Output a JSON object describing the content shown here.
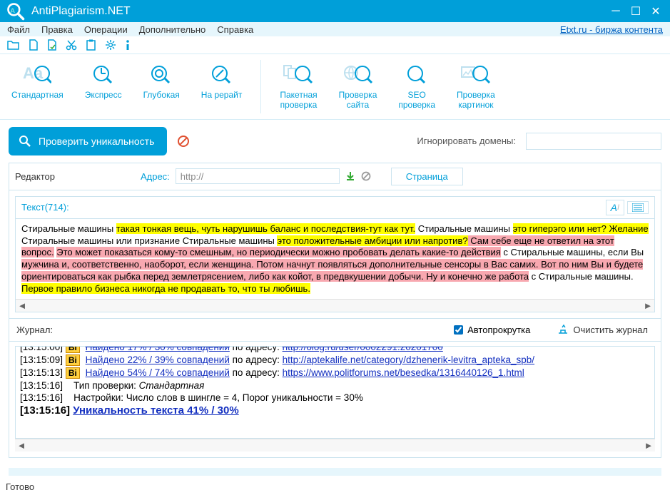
{
  "titlebar": {
    "title": "AntiPlagiarism.NET"
  },
  "menubar": {
    "items": [
      "Файл",
      "Правка",
      "Операции",
      "Дополнительно",
      "Справка"
    ],
    "etxt_link": "Etxt.ru - биржа контента"
  },
  "toolbar_big": {
    "group1": [
      "Стандартная",
      "Экспресс",
      "Глубокая",
      "На рерайт"
    ],
    "group2": [
      "Пакетная\nпроверка",
      "Проверка\nсайта",
      "SEO\nпроверка",
      "Проверка\nкартинок"
    ]
  },
  "check_row": {
    "check_btn": "Проверить уникальность",
    "ignore_label": "Игнорировать домены:",
    "ignore_value": ""
  },
  "editor": {
    "title": "Редактор",
    "addr_label": "Адрес:",
    "addr_value": "http://",
    "tab": "Страница",
    "text_label": "Текст(714):",
    "content": {
      "s1": "Стиральные машины ",
      "s2": "такая тонкая вещь, чуть нарушишь баланс и последствия-тут как тут.",
      "s3": " Стиральные машины ",
      "s4": "это гиперэго или нет? Желание",
      "s5": " Стиральные машины ",
      "s6": "или признание",
      "s7": " Стиральные машины ",
      "s8": "это положительные амбиции или напротив?",
      "s9": " Сам себе еще не ответил на этот вопрос.",
      "s10": " ",
      "s11": "Это может показаться кому-то смешным, но периодически можно пробовать делать какие-то действия",
      "s12": " с Стиральные машины, если Вы ",
      "s13": "мужчина и, соответственно, наоборот, если женщина. Потом начнут появляться дополнительные сенсоры в Вас самих. Вот по ним Вы и будете ориентироваться как рыбка перед землетрясением, либо как койот, в предвкушении добычи. Ну и конечно же работа",
      "s14": " с Стиральные машины.",
      "s15": " Первое правило бизнеса никогда не продавать то, что ты любишь."
    }
  },
  "journal": {
    "title": "Журнал:",
    "autoscroll": "Автопрокрутка",
    "clear": "Очистить журнал",
    "rows": [
      {
        "time": "[13:15:09]",
        "bi": "Bi",
        "link_text": "Найдено 22% / 39% совпадений",
        "mid": " по адресу: ",
        "url": "http://aptekalife.net/category/dzhenerik-levitra_apteka_spb/"
      },
      {
        "time": "[13:15:13]",
        "bi": "Bi",
        "link_text": "Найдено 54% / 74% совпадений",
        "mid": " по адресу: ",
        "url": "https://www.politforums.net/besedka/1316440126_1.html"
      },
      {
        "time": "[13:15:16]",
        "text_a": "Тип проверки: ",
        "text_b": "Стандартная"
      },
      {
        "time": "[13:15:16]",
        "text_a": "Настройки: Число слов в шингле = 4, Порог уникальности = 30%"
      },
      {
        "time": "[13:15:16]",
        "bold_link": "Уникальность текста 41% / 30%"
      }
    ]
  },
  "status": {
    "text": "Готово"
  }
}
